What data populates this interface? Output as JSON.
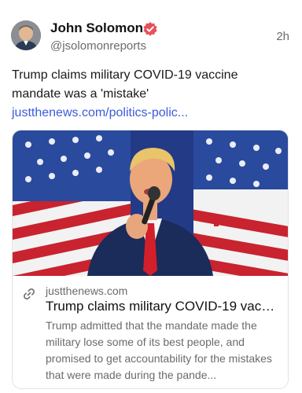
{
  "post": {
    "author_name": "John Solomon",
    "handle": "@jsolomonreports",
    "timestamp": "2h",
    "text_before_link": "Trump claims military COVID-19 vaccine mandate was a 'mistake' ",
    "link_text": "justthenews.com/politics-polic...",
    "verified": true
  },
  "card": {
    "domain": "justthenews.com",
    "title": "Trump claims military COVID-19 vacci...",
    "description": "Trump admitted that the mandate made the military lose some of its best people, and promised to get accountability for the mistakes that were made during the pande..."
  },
  "colors": {
    "accent_link": "#3b5bdb",
    "verified_badge": "#e8505b",
    "muted_text": "#6b6b6b"
  },
  "icons": {
    "verified": "verified-badge-icon",
    "link": "link-icon"
  }
}
